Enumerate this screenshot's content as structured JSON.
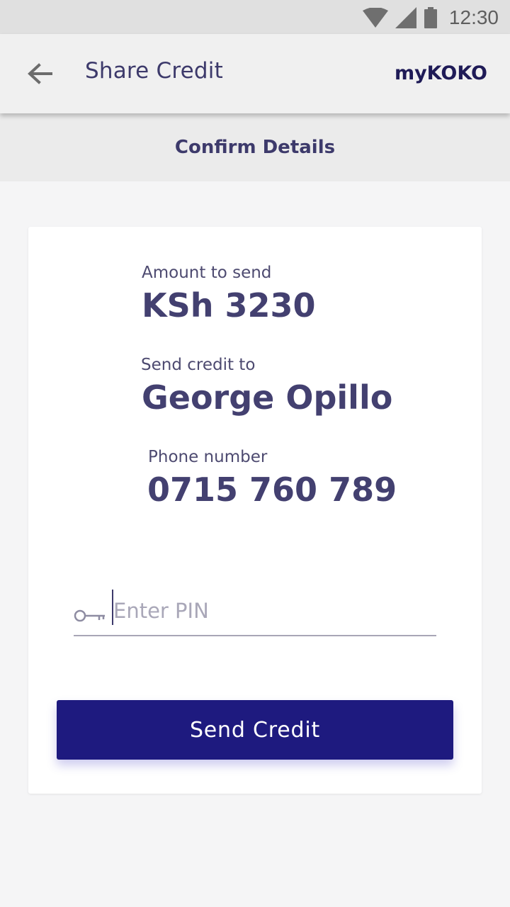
{
  "status_bar": {
    "time": "12:30",
    "icons": [
      "wifi-icon",
      "signal-icon",
      "battery-icon"
    ]
  },
  "app_bar": {
    "back_icon": "arrow-left-icon",
    "title": "Share Credit",
    "brand": "myKOKO"
  },
  "subheader": {
    "title": "Confirm Details"
  },
  "details": {
    "amount_label": "Amount to send",
    "amount_value": "KSh 3230",
    "recipient_label": "Send credit to",
    "recipient_value": "George Opillo",
    "phone_label": "Phone number",
    "phone_value": "0715 760 789"
  },
  "pin": {
    "icon": "key-icon",
    "placeholder": "Enter PIN",
    "value": ""
  },
  "send_button": {
    "label": "Send Credit"
  },
  "colors": {
    "primary": "#1e1a7f",
    "text": "#434070",
    "app_bar_bg": "#f0f0f0"
  }
}
